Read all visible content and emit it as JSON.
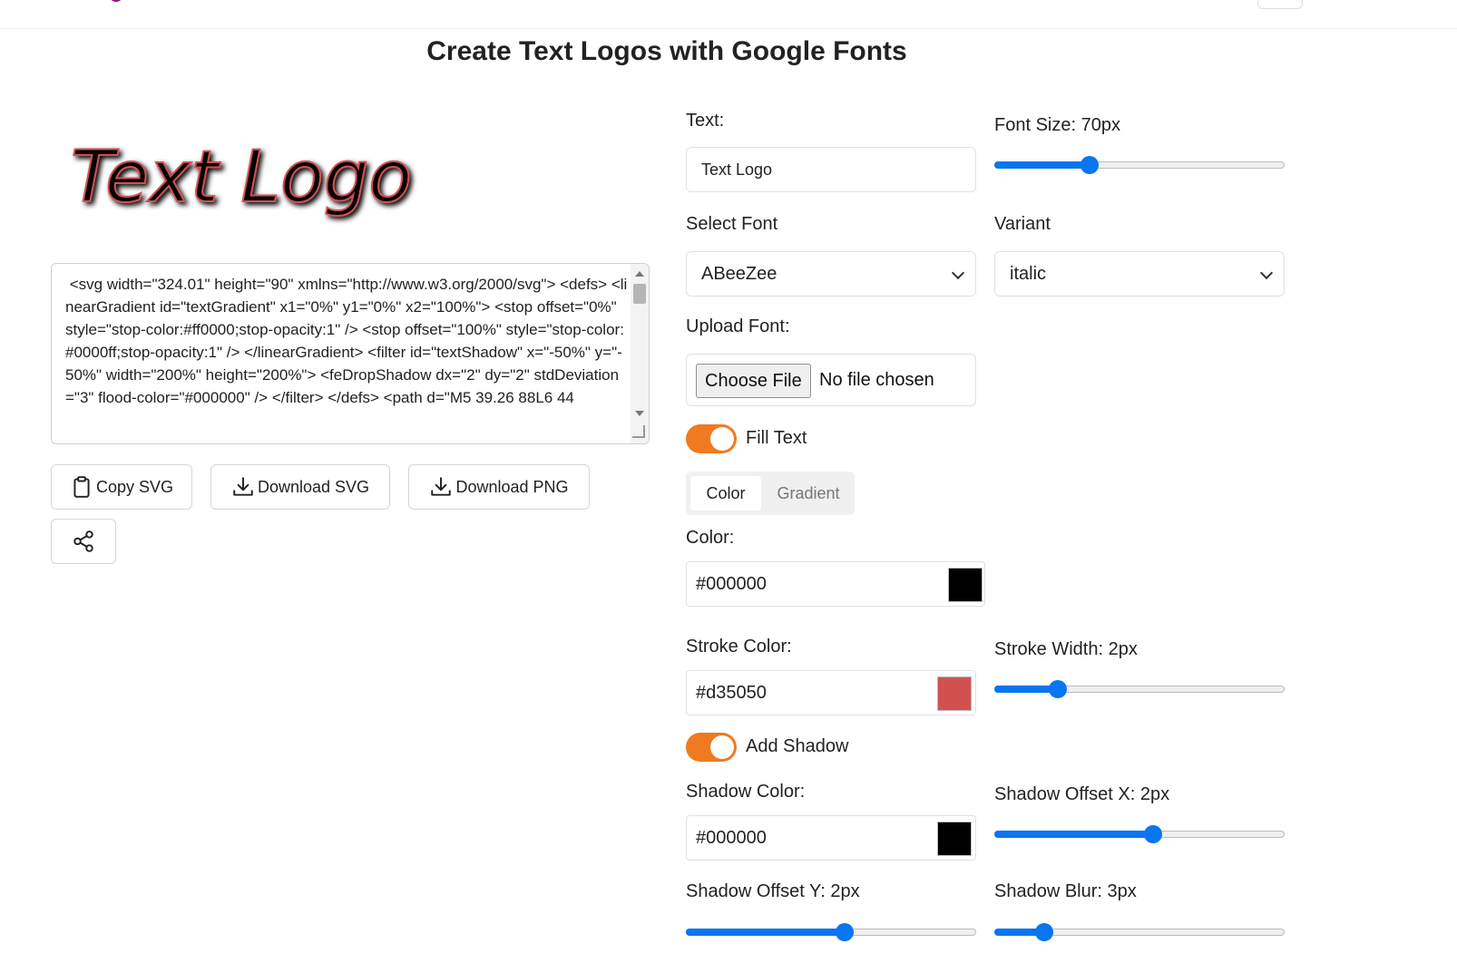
{
  "page": {
    "title": "Create Text Logos with Google Fonts"
  },
  "preview": {
    "logo_text": "Text Logo",
    "fill_color": "#000000",
    "stroke_color": "#d35050",
    "shadow_color": "#000000"
  },
  "code": {
    "svg_source": " <svg width=\"324.01\" height=\"90\" xmlns=\"http://www.w3.org/2000/svg\"> <defs> <linearGradient id=\"textGradient\" x1=\"0%\" y1=\"0%\" x2=\"100%\"> <stop offset=\"0%\" style=\"stop-color:#ff0000;stop-opacity:1\" /> <stop offset=\"100%\" style=\"stop-color:#0000ff;stop-opacity:1\" /> </linearGradient> <filter id=\"textShadow\" x=\"-50%\" y=\"-50%\" width=\"200%\" height=\"200%\"> <feDropShadow dx=\"2\" dy=\"2\" stdDeviation=\"3\" flood-color=\"#000000\" /> </filter> </defs> <path d=\"M5 39.26 88L6 44"
  },
  "actions": {
    "copy_svg": "Copy SVG",
    "download_svg": "Download SVG",
    "download_png": "Download PNG"
  },
  "icons": {
    "clipboard": "clipboard-icon",
    "download": "download-icon",
    "share": "share-icon",
    "chevron": "chevron-down-icon"
  },
  "form": {
    "text_label": "Text:",
    "text_value": "Text Logo",
    "font_size_label": "Font Size: 70px",
    "font_size": {
      "value": 70,
      "min": 10,
      "max": 200
    },
    "select_font_label": "Select Font",
    "font_value": "ABeeZee",
    "variant_label": "Variant",
    "variant_value": "italic",
    "upload_font_label": "Upload Font:",
    "choose_file": "Choose File",
    "no_file": "No file chosen",
    "fill_text_label": "Fill Text",
    "fill_text_on": true,
    "fill_tabs": [
      "Color",
      "Gradient"
    ],
    "fill_tab_active": "Color",
    "color_label": "Color:",
    "color_value": "#000000",
    "stroke_color_label": "Stroke Color:",
    "stroke_color_value": "#d35050",
    "stroke_width_label": "Stroke Width: 2px",
    "stroke_width": {
      "value": 2,
      "min": 0,
      "max": 10
    },
    "add_shadow_label": "Add Shadow",
    "add_shadow_on": true,
    "shadow_color_label": "Shadow Color:",
    "shadow_color_value": "#000000",
    "shadow_offset_x_label": "Shadow Offset X: 2px",
    "shadow_offset_x": {
      "value": 2,
      "min": -20,
      "max": 20
    },
    "shadow_offset_y_label": "Shadow Offset Y: 2px",
    "shadow_offset_y": {
      "value": 2,
      "min": -20,
      "max": 20
    },
    "shadow_blur_label": "Shadow Blur: 3px",
    "shadow_blur": {
      "value": 3,
      "min": 0,
      "max": 20
    }
  }
}
